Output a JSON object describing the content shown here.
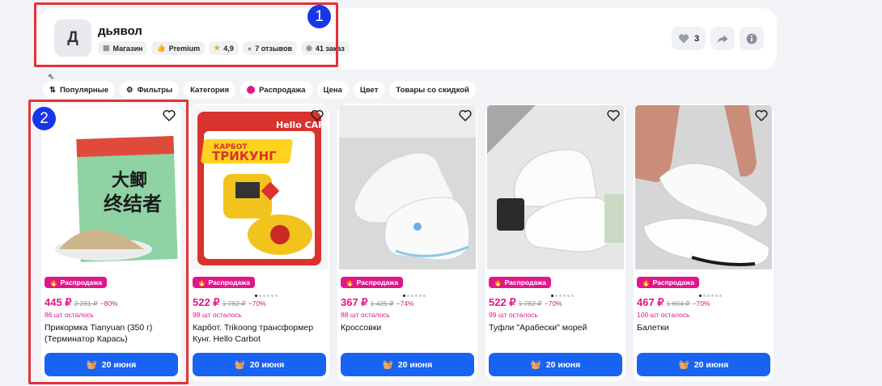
{
  "shop": {
    "avatar_letter": "Д",
    "name": "дьявол",
    "badges": [
      {
        "icon": "store-icon",
        "label": "Магазин"
      },
      {
        "icon": "thumbs-up-icon",
        "label": "Premium"
      },
      {
        "icon": "star-icon",
        "label": "4,9"
      },
      {
        "icon": "chat-icon",
        "label": "7 отзывов"
      },
      {
        "icon": "box-icon",
        "label": "41 заказ"
      }
    ],
    "likes_count": "3"
  },
  "annotations": [
    "1",
    "2"
  ],
  "filters": [
    "Популярные",
    "Фильтры",
    "Категория",
    "Распродажа",
    "Цена",
    "Цвет",
    "Товары со скидкой"
  ],
  "products": [
    {
      "sale_label": "Распродажа",
      "price": "445 ₽",
      "old_price": "2 281 ₽",
      "discount": "−80%",
      "stock": "86 шт осталось",
      "title": "Прикормка Tianyuan (350 г) (Терминатор Карась)",
      "buy_label": "20 июня",
      "dots": 0
    },
    {
      "sale_label": "Распродажа",
      "price": "522 ₽",
      "old_price": "1 782 ₽",
      "discount": "−70%",
      "stock": "98 шт осталось",
      "title": "Карбот. Trikoong трансформер Кунг. Hello Carbot",
      "buy_label": "20 июня",
      "dots": 6,
      "image_text": {
        "brand": "Hello CARBOT",
        "top": "КАРБОТ",
        "main": "ТРИКУНГ"
      }
    },
    {
      "sale_label": "Распродажа",
      "price": "367 ₽",
      "old_price": "1 425 ₽",
      "discount": "−74%",
      "stock": "88 шт осталось",
      "title": "Кроссовки",
      "buy_label": "20 июня",
      "dots": 6
    },
    {
      "sale_label": "Распродажа",
      "price": "522 ₽",
      "old_price": "1 782 ₽",
      "discount": "−70%",
      "stock": "99 шт осталось",
      "title": "Туфли \"Арабески\" морей",
      "buy_label": "20 июня",
      "dots": 6
    },
    {
      "sale_label": "Распродажа",
      "price": "467 ₽",
      "old_price": "1 604 ₽",
      "discount": "−70%",
      "stock": "100 шт осталось",
      "title": "Балетки",
      "buy_label": "20 июня",
      "dots": 6
    }
  ],
  "colors": {
    "accent": "#e0168a",
    "button": "#1863f2",
    "annotation_box": "#e53238",
    "annotation_badge": "#1736e8"
  }
}
